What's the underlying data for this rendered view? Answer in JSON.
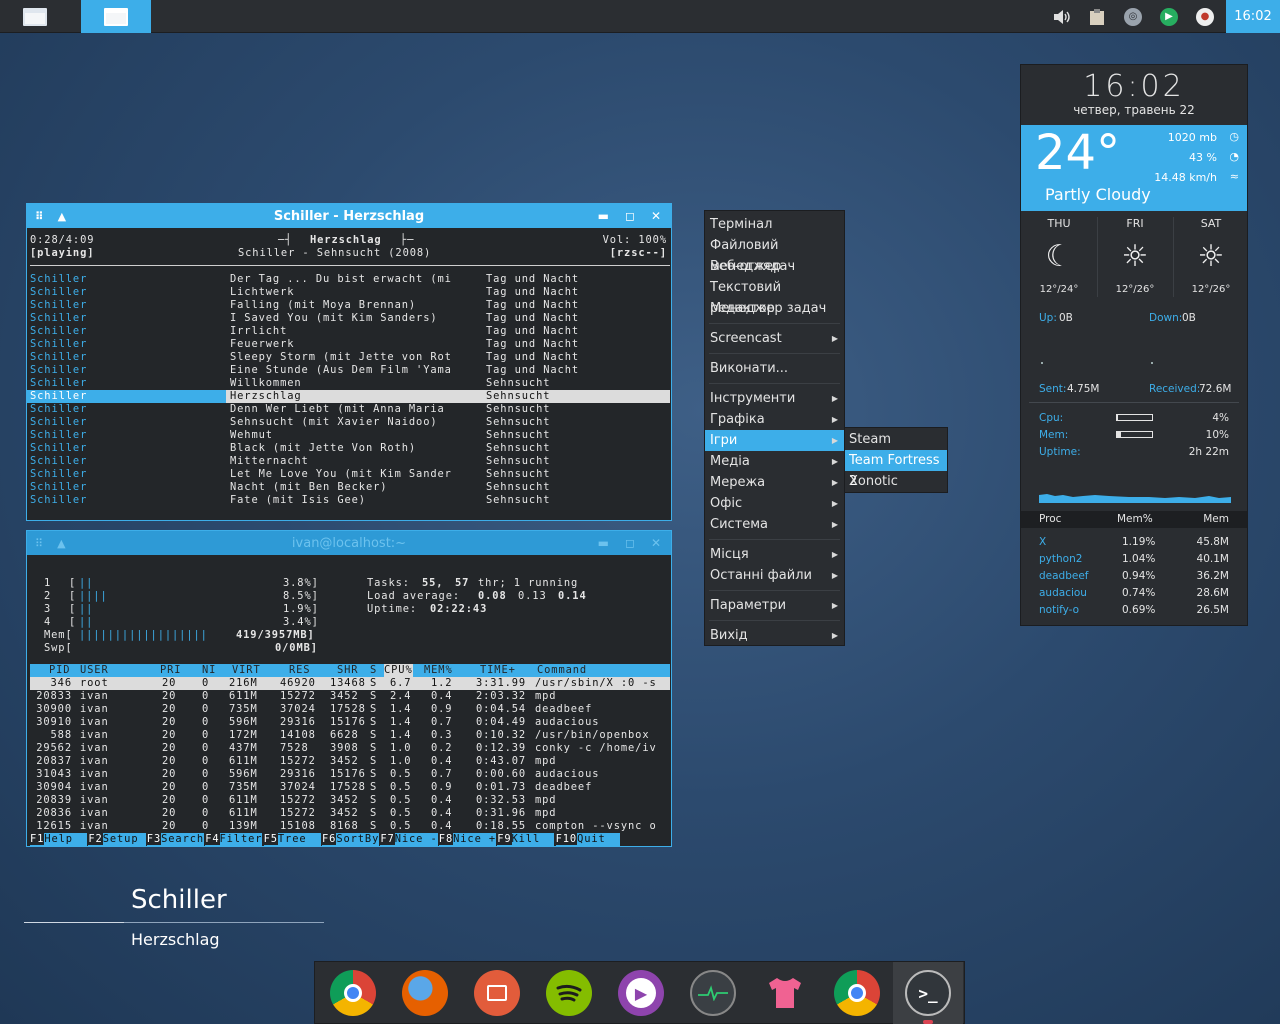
{
  "taskbar": {
    "clock": "16:02"
  },
  "cmus": {
    "title": "Schiller - Herzschlag",
    "position": "0:28/4:09",
    "status": "[playing]",
    "now_track": "Herzschlag",
    "now_line": "Schiller - Sehnsucht (2008)",
    "volume": "Vol: 100%",
    "flags": "[rzsc--]",
    "rows": [
      {
        "artist": "Schiller",
        "title": "Der Tag ... Du bist erwacht (mi",
        "album": "Tag und Nacht"
      },
      {
        "artist": "Schiller",
        "title": "Lichtwerk",
        "album": "Tag und Nacht"
      },
      {
        "artist": "Schiller",
        "title": "Falling (mit Moya Brennan)",
        "album": "Tag und Nacht"
      },
      {
        "artist": "Schiller",
        "title": "I Saved You (mit Kim Sanders)",
        "album": "Tag und Nacht"
      },
      {
        "artist": "Schiller",
        "title": "Irrlicht",
        "album": "Tag und Nacht"
      },
      {
        "artist": "Schiller",
        "title": "Feuerwerk",
        "album": "Tag und Nacht"
      },
      {
        "artist": "Schiller",
        "title": "Sleepy Storm (mit Jette von Rot",
        "album": "Tag und Nacht"
      },
      {
        "artist": "Schiller",
        "title": "Eine Stunde (Aus Dem Film 'Yama",
        "album": "Tag und Nacht"
      },
      {
        "artist": "Schiller",
        "title": "Willkommen",
        "album": "Sehnsucht"
      },
      {
        "artist": "Schiller",
        "title": "Herzschlag",
        "album": "Sehnsucht",
        "selected": true
      },
      {
        "artist": "Schiller",
        "title": "Denn Wer Liebt (mit Anna Maria",
        "album": "Sehnsucht"
      },
      {
        "artist": "Schiller",
        "title": "Sehnsucht (mit Xavier Naidoo)",
        "album": "Sehnsucht"
      },
      {
        "artist": "Schiller",
        "title": "Wehmut",
        "album": "Sehnsucht"
      },
      {
        "artist": "Schiller",
        "title": "Black (mit Jette Von Roth)",
        "album": "Sehnsucht"
      },
      {
        "artist": "Schiller",
        "title": "Mitternacht",
        "album": "Sehnsucht"
      },
      {
        "artist": "Schiller",
        "title": "Let Me Love You (mit Kim Sander",
        "album": "Sehnsucht"
      },
      {
        "artist": "Schiller",
        "title": "Nacht (mit Ben Becker)",
        "album": "Sehnsucht"
      },
      {
        "artist": "Schiller",
        "title": "Fate (mit Isis Gee)",
        "album": "Sehnsucht"
      }
    ]
  },
  "htop": {
    "title": "ivan@localhost:~",
    "cpus": [
      {
        "id": "1",
        "bar": "||",
        "pct": "3.8%]"
      },
      {
        "id": "2",
        "bar": "||||",
        "pct": "8.5%]"
      },
      {
        "id": "3",
        "bar": "||",
        "pct": "1.9%]"
      },
      {
        "id": "4",
        "bar": "||",
        "pct": "3.4%]"
      }
    ],
    "mem_label": "Mem[",
    "mem_bar": "||||||||||||||||||",
    "mem_val": "419/3957MB]",
    "swp_label": "Swp[",
    "swp_val": "0/0MB]",
    "tasks_label": "Tasks:",
    "tasks_val": "55,",
    "thr_val": "57",
    "tasks_rest": "thr; 1 running",
    "load_label": "Load average:",
    "load1": "0.08",
    "load5": "0.13",
    "load15": "0.14",
    "uptime_label": "Uptime:",
    "uptime_val": "02:22:43",
    "headers": [
      "PID",
      "USER",
      "PRI",
      "NI",
      "VIRT",
      "RES",
      "SHR",
      "S",
      "CPU%",
      "MEM%",
      "TIME+",
      "Command"
    ],
    "procs": [
      [
        "346",
        "root",
        "20",
        "0",
        "216M",
        "46920",
        "13468",
        "S",
        "6.7",
        "1.2",
        "3:31.99",
        "/usr/sbin/X :0 -s"
      ],
      [
        "20833",
        "ivan",
        "20",
        "0",
        "611M",
        "15272",
        "3452",
        "S",
        "2.4",
        "0.4",
        "2:03.32",
        "mpd"
      ],
      [
        "30900",
        "ivan",
        "20",
        "0",
        "735M",
        "37024",
        "17528",
        "S",
        "1.4",
        "0.9",
        "0:04.54",
        "deadbeef"
      ],
      [
        "30910",
        "ivan",
        "20",
        "0",
        "596M",
        "29316",
        "15176",
        "S",
        "1.4",
        "0.7",
        "0:04.49",
        "audacious"
      ],
      [
        "588",
        "ivan",
        "20",
        "0",
        "172M",
        "14108",
        "6628",
        "S",
        "1.4",
        "0.3",
        "0:10.32",
        "/usr/bin/openbox"
      ],
      [
        "29562",
        "ivan",
        "20",
        "0",
        "437M",
        "7528",
        "3908",
        "S",
        "1.0",
        "0.2",
        "0:12.39",
        "conky -c /home/iv"
      ],
      [
        "20837",
        "ivan",
        "20",
        "0",
        "611M",
        "15272",
        "3452",
        "S",
        "1.0",
        "0.4",
        "0:43.07",
        "mpd"
      ],
      [
        "31043",
        "ivan",
        "20",
        "0",
        "596M",
        "29316",
        "15176",
        "S",
        "0.5",
        "0.7",
        "0:00.60",
        "audacious"
      ],
      [
        "30904",
        "ivan",
        "20",
        "0",
        "735M",
        "37024",
        "17528",
        "S",
        "0.5",
        "0.9",
        "0:01.73",
        "deadbeef"
      ],
      [
        "20839",
        "ivan",
        "20",
        "0",
        "611M",
        "15272",
        "3452",
        "S",
        "0.5",
        "0.4",
        "0:32.53",
        "mpd"
      ],
      [
        "20836",
        "ivan",
        "20",
        "0",
        "611M",
        "15272",
        "3452",
        "S",
        "0.5",
        "0.4",
        "0:31.96",
        "mpd"
      ],
      [
        "12615",
        "ivan",
        "20",
        "0",
        "139M",
        "15108",
        "8168",
        "S",
        "0.5",
        "0.4",
        "0:18.55",
        "compton --vsync o"
      ]
    ],
    "fkeys": [
      {
        "key": "F1",
        "label": "Help  "
      },
      {
        "key": "F2",
        "label": "Setup "
      },
      {
        "key": "F3",
        "label": "Search"
      },
      {
        "key": "F4",
        "label": "Filter"
      },
      {
        "key": "F5",
        "label": "Tree  "
      },
      {
        "key": "F6",
        "label": "SortBy"
      },
      {
        "key": "F7",
        "label": "Nice -"
      },
      {
        "key": "F8",
        "label": "Nice +"
      },
      {
        "key": "F9",
        "label": "Kill  "
      },
      {
        "key": "F10",
        "label": "Quit  "
      }
    ]
  },
  "menu": {
    "items": [
      {
        "label": "Термінал"
      },
      {
        "label": "Файловий менеджер"
      },
      {
        "label": "Веб-оглядач"
      },
      {
        "label": "Текстовий редактор"
      },
      {
        "label": "Менеджер задач"
      },
      {
        "label": "Screencast",
        "sub": true
      },
      {
        "label": "Виконати..."
      },
      {
        "label": "Інструменти",
        "sub": true
      },
      {
        "label": "Графіка",
        "sub": true
      },
      {
        "label": "Ігри",
        "sub": true,
        "hl": true
      },
      {
        "label": "Медіа",
        "sub": true
      },
      {
        "label": "Мережа",
        "sub": true
      },
      {
        "label": "Офіс",
        "sub": true
      },
      {
        "label": "Система",
        "sub": true
      },
      {
        "label": "Місця",
        "sub": true
      },
      {
        "label": "Останні файли",
        "sub": true
      },
      {
        "label": "Параметри",
        "sub": true
      },
      {
        "label": "Вихід",
        "sub": true
      }
    ],
    "games": [
      {
        "label": "Steam"
      },
      {
        "label": "Team Fortress 2",
        "hl": true
      },
      {
        "label": "Xonotic"
      }
    ]
  },
  "conky": {
    "time": "16:02",
    "date": "четвер, травень 22",
    "temp": "24°",
    "pressure": "1020 mb",
    "humidity": "43 %",
    "wind": "14.48 km/h",
    "condition": "Partly Cloudy",
    "forecast": [
      {
        "day": "THU",
        "icon": "moon-icon",
        "range": "12°/24°"
      },
      {
        "day": "FRI",
        "icon": "sun-icon",
        "range": "12°/26°"
      },
      {
        "day": "SAT",
        "icon": "sun-icon",
        "range": "12°/26°"
      }
    ],
    "up_label": "Up:",
    "up_val": "0B",
    "down_label": "Down:",
    "down_val": "0B",
    "sent_label": "Sent:",
    "sent_val": "4.75M",
    "recv_label": "Received:",
    "recv_val": "72.6M",
    "cpu_label": "Cpu:",
    "cpu_val": "4%",
    "cpu_frac": 0.04,
    "mem_label": "Mem:",
    "mem_val": "10%",
    "mem_frac": 0.1,
    "uptime_label": "Uptime:",
    "uptime_val": "2h 22m",
    "proc_headers": [
      "Proc",
      "Mem%",
      "Mem"
    ],
    "procs": [
      {
        "name": "X",
        "pct": "1.19%",
        "mem": "45.8M"
      },
      {
        "name": "python2",
        "pct": "1.04%",
        "mem": "40.1M"
      },
      {
        "name": "deadbeef",
        "pct": "0.94%",
        "mem": "36.2M"
      },
      {
        "name": "audaciou",
        "pct": "0.74%",
        "mem": "28.6M"
      },
      {
        "name": "notify-o",
        "pct": "0.69%",
        "mem": "26.5M"
      }
    ]
  },
  "now_playing": {
    "artist": "Schiller",
    "title": "Herzschlag"
  },
  "dock": [
    {
      "name": "chrome-icon"
    },
    {
      "name": "firefox-icon"
    },
    {
      "name": "app-store-icon"
    },
    {
      "name": "spotify-icon"
    },
    {
      "name": "media-player-icon"
    },
    {
      "name": "system-monitor-icon"
    },
    {
      "name": "tshirt-icon"
    },
    {
      "name": "chromium-icon"
    },
    {
      "name": "terminal-icon"
    }
  ]
}
